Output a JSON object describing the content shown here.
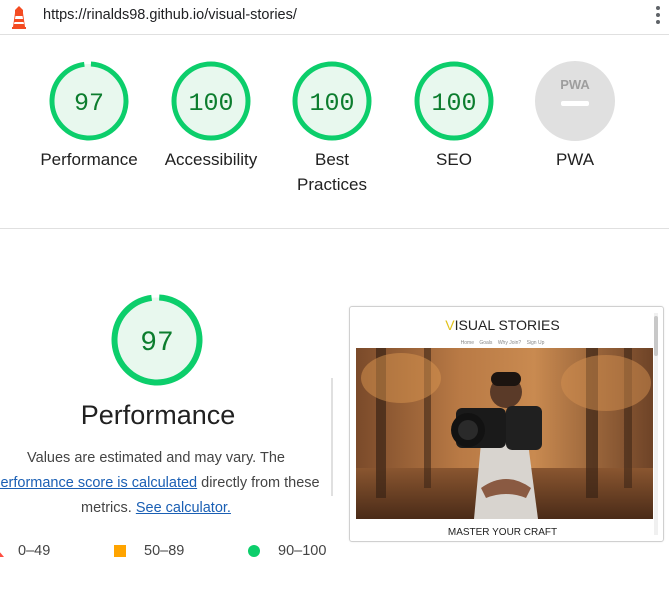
{
  "browser": {
    "url": "https://rinalds98.github.io/visual-stories/"
  },
  "summary": {
    "categories": [
      {
        "label": "Performance",
        "score": "97"
      },
      {
        "label": "Accessibility",
        "score": "100"
      },
      {
        "label": "Best",
        "label2": "Practices",
        "score": "100"
      },
      {
        "label": "SEO",
        "score": "100"
      },
      {
        "label": "PWA",
        "score": ""
      }
    ]
  },
  "performance": {
    "score": "97",
    "title": "Performance",
    "desc_1": "Values are estimated and may vary. The",
    "desc_link_1": "performance score is calculated",
    "desc_2": " directly from these",
    "desc_3": "metrics. ",
    "desc_link_2": "See calculator.",
    "legend": {
      "fail": "0–49",
      "average": "50–89",
      "pass": "90–100"
    }
  },
  "screenshot": {
    "site_title_first": "V",
    "site_title_rest": "ISUAL STORIES",
    "nav": [
      "Home",
      "Goals",
      "Why Join?",
      "Sign Up"
    ],
    "caption": "MASTER YOUR CRAFT"
  },
  "pwa_badge": "PWA",
  "colors": {
    "pass": "#0cce6b",
    "pass_text": "#0c7d2e",
    "pass_bg": "#e8f8ee",
    "average": "#ffa400",
    "fail": "#ff4e42",
    "na": "#e0e0e0"
  }
}
